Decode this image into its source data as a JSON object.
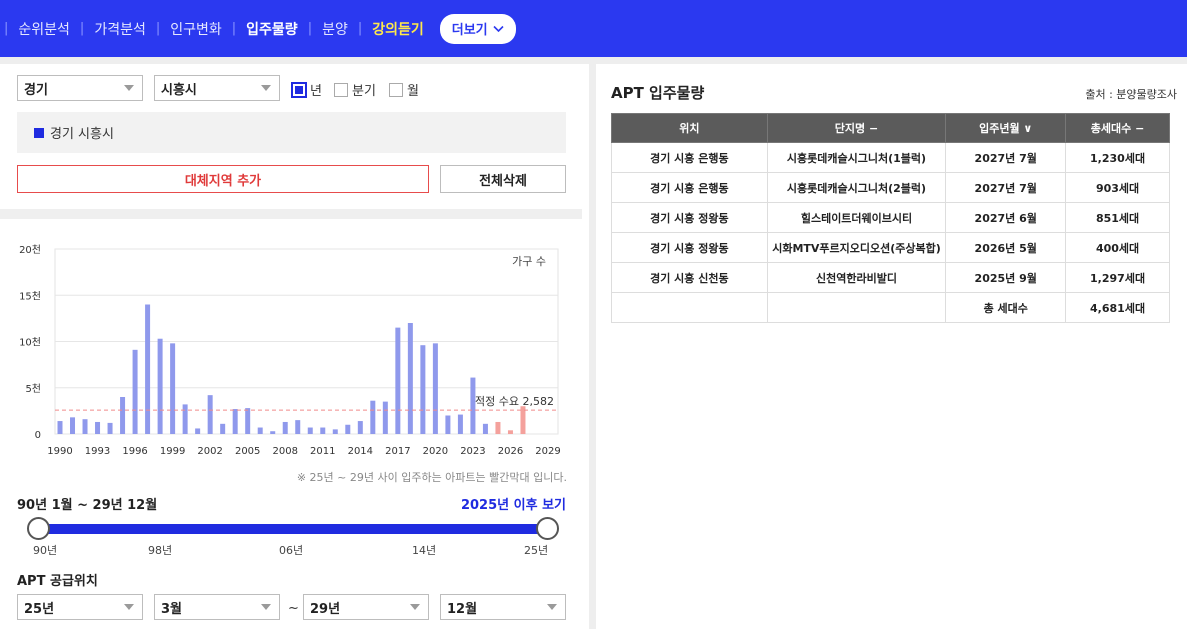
{
  "nav": {
    "items": [
      {
        "label": "순위분석",
        "style": "normal"
      },
      {
        "label": "가격분석",
        "style": "normal"
      },
      {
        "label": "인구변화",
        "style": "normal"
      },
      {
        "label": "입주물량",
        "style": "active"
      },
      {
        "label": "분양",
        "style": "normal"
      },
      {
        "label": "강의듣기",
        "style": "yellow"
      }
    ],
    "more_label": "더보기"
  },
  "filters": {
    "province": "경기",
    "city": "시흥시",
    "period_options": [
      {
        "label": "년",
        "checked": true
      },
      {
        "label": "분기",
        "checked": false
      },
      {
        "label": "월",
        "checked": false
      }
    ]
  },
  "selected_region": "경기 시흥시",
  "buttons": {
    "add_alt": "대체지역 추가",
    "delete_all": "전체삭제"
  },
  "chart_data": {
    "type": "bar",
    "y_ticks": [
      "0",
      "5천",
      "10천",
      "15천",
      "20천"
    ],
    "x_ticks": [
      "1990",
      "1993",
      "1996",
      "1999",
      "2002",
      "2005",
      "2008",
      "2011",
      "2014",
      "2017",
      "2020",
      "2023",
      "2026",
      "2029"
    ],
    "ylim": [
      0,
      20000
    ],
    "unit_label": "가구 수",
    "reference": {
      "label": "적정 수요 2,582",
      "value": 2582
    },
    "years": [
      1990,
      1991,
      1992,
      1993,
      1994,
      1995,
      1996,
      1997,
      1998,
      1999,
      2000,
      2001,
      2002,
      2003,
      2004,
      2005,
      2006,
      2007,
      2008,
      2009,
      2010,
      2011,
      2012,
      2013,
      2014,
      2015,
      2016,
      2017,
      2018,
      2019,
      2020,
      2021,
      2022,
      2023,
      2024,
      2025,
      2026,
      2027,
      2028,
      2029
    ],
    "values": [
      1400,
      1800,
      1600,
      1300,
      1200,
      4000,
      9100,
      14000,
      10300,
      9800,
      3200,
      600,
      4200,
      1100,
      2700,
      2800,
      700,
      300,
      1300,
      1500,
      700,
      700,
      500,
      1000,
      1400,
      3600,
      3500,
      11500,
      12000,
      9600,
      9800,
      2000,
      2100,
      6100,
      1100,
      1300,
      400,
      3000,
      0,
      0
    ],
    "highlight_years": [
      2025,
      2026,
      2027,
      2028,
      2029
    ],
    "colors": {
      "normal": "#8f99ec",
      "highlight": "#f4a19c",
      "reference": "#f08a8a"
    }
  },
  "chart_note": "※ 25년 ~ 29년 사이 입주하는 아파트는 빨간막대 입니다.",
  "range": {
    "title": "90년 1월 ~ 29년 12월",
    "link": "2025년 이후 보기",
    "labels": [
      "90년",
      "98년",
      "06년",
      "14년",
      "25년"
    ]
  },
  "supply": {
    "title": "APT 공급위치",
    "start_year": "25년",
    "start_month": "3월",
    "tilde": "~",
    "end_year": "29년",
    "end_month": "12월"
  },
  "right": {
    "title": "APT 입주물량",
    "source": "출처 : 분양물량조사",
    "headers": [
      "위치",
      "단지명 −",
      "입주년월 ∨",
      "총세대수 −"
    ],
    "rows": [
      [
        "경기 시흥 은행동",
        "시흥롯데캐슬시그니처(1블럭)",
        "2027년 7월",
        "1,230세대"
      ],
      [
        "경기 시흥 은행동",
        "시흥롯데캐슬시그니처(2블럭)",
        "2027년 7월",
        "903세대"
      ],
      [
        "경기 시흥 정왕동",
        "힐스테이트더웨이브시티",
        "2027년 6월",
        "851세대"
      ],
      [
        "경기 시흥 정왕동",
        "시화MTV푸르지오디오션(주상복합)",
        "2026년 5월",
        "400세대"
      ],
      [
        "경기 시흥 신천동",
        "신천역한라비발디",
        "2025년 9월",
        "1,297세대"
      ]
    ],
    "total_label": "총 세대수",
    "total_value": "4,681세대"
  }
}
